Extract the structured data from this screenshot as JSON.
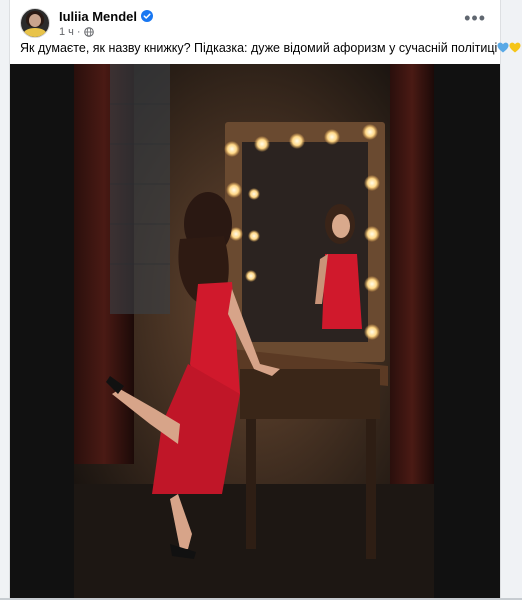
{
  "post": {
    "author": "Iuliia Mendel",
    "time": "1 ч",
    "dot": "·",
    "caption": "Як думаєте, як назву книжку? Підказка: дуже відомий афоризм у сучасній політиці",
    "more_label": "•••"
  },
  "icons": {
    "verified": "verified-badge-icon",
    "audience": "globe-icon",
    "more": "more-options-icon",
    "hearts": [
      "blue-heart-icon",
      "yellow-heart-icon"
    ]
  },
  "colors": {
    "verified": "#1877f2",
    "heart_blue": "#5aa9e6",
    "heart_yellow": "#f5c518",
    "dress": "#d0192c"
  }
}
